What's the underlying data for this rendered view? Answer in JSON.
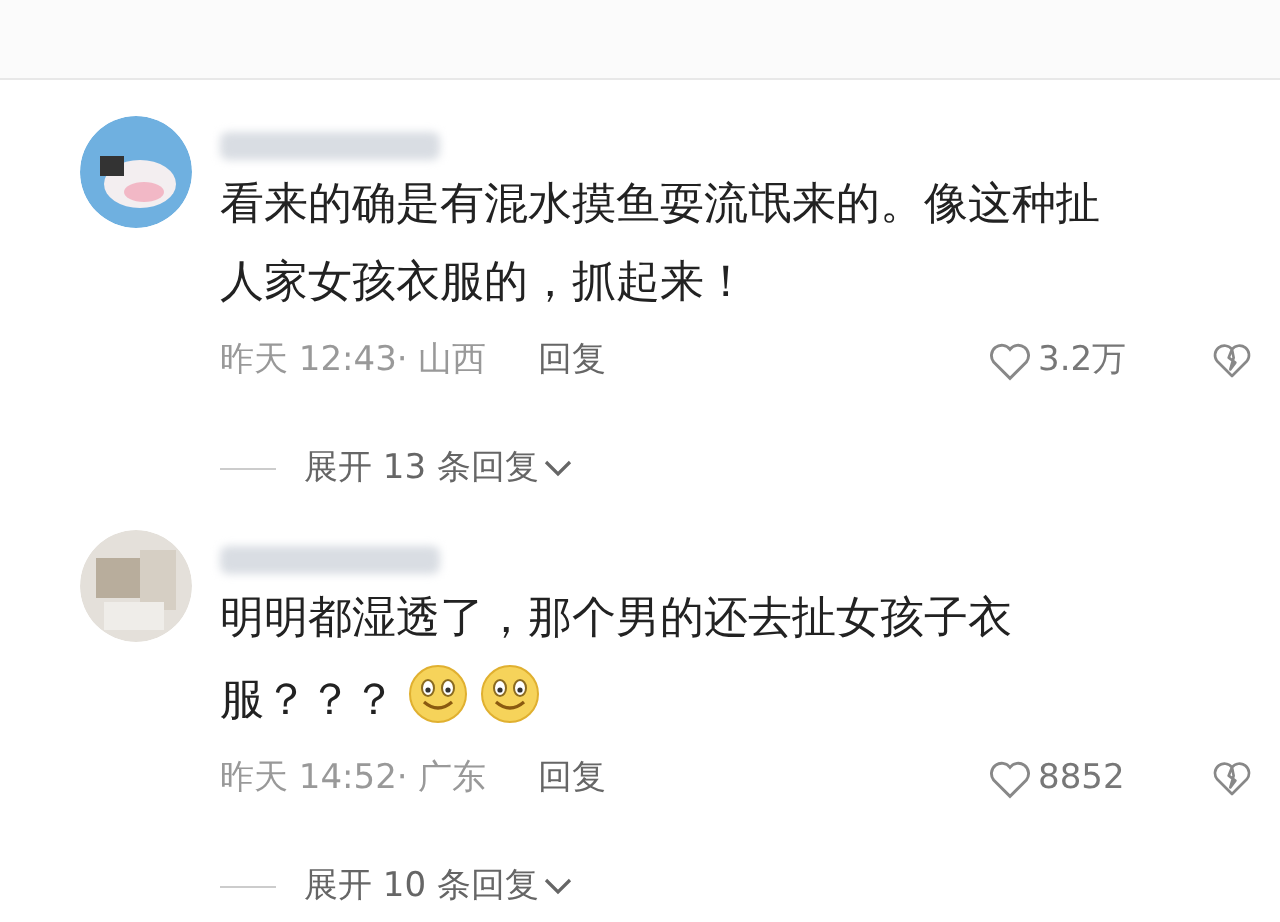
{
  "comments": [
    {
      "lines": [
        "看来的确是有混水摸鱼耍流氓来的。像这种扯",
        "人家女孩衣服的，抓起来！"
      ],
      "time": "昨天 12:43",
      "region": "· 山西",
      "reply": "回复",
      "likes": "3.2万",
      "expand": "展开 13 条回复"
    },
    {
      "lines": [
        "明明都湿透了，那个男的还去扯女孩子衣",
        "服？？？"
      ],
      "emojis": [
        {
          "kind": "smile"
        },
        {
          "kind": "smile"
        }
      ],
      "time": "昨天 14:52",
      "region": "· 广东",
      "reply": "回复",
      "likes": "8852",
      "expand": "展开 10 条回复"
    }
  ]
}
